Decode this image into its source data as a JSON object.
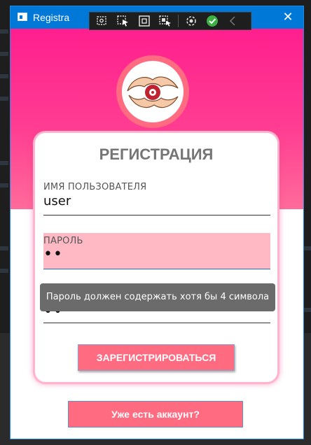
{
  "window": {
    "title": "Registra",
    "close_glyph": "✕"
  },
  "debug_toolbar": {
    "icons": [
      "inspect-icon",
      "select-element-icon",
      "display-layout-icon",
      "track-focus-icon",
      "hot-reload-icon",
      "check-icon",
      "collapse-chevron-icon"
    ]
  },
  "form": {
    "title": "РЕГИСТРАЦИЯ",
    "username": {
      "label": "ИМЯ ПОЛЬЗОВАТЕЛЯ",
      "value": "user"
    },
    "password": {
      "label": "ПАРОЛЬ",
      "value": "••"
    },
    "confirm_password": {
      "value": "••"
    },
    "tooltip": "Пароль должен содержать хотя бы 4 символа",
    "register_label": "ЗАРЕГИСТРИРОВАТЬСЯ"
  },
  "login_link_label": "Уже есть аккаунт?",
  "colors": {
    "titlebar": "#0078d7",
    "gradient_top": "#ff1f8e",
    "button": "#ff6b80",
    "error_field": "#ffb9c4",
    "tooltip": "#6b6b6b"
  }
}
